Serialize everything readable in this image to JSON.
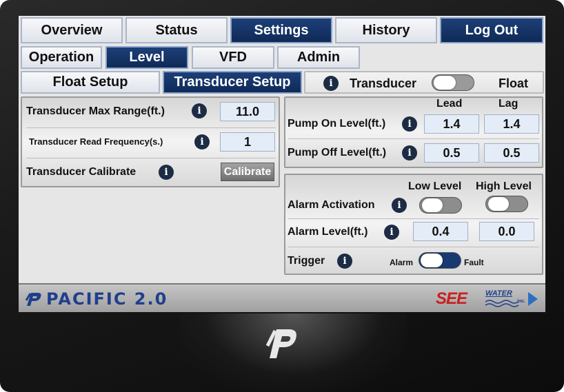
{
  "nav": {
    "tabs": [
      {
        "label": "Overview",
        "active": false
      },
      {
        "label": "Status",
        "active": false
      },
      {
        "label": "Settings",
        "active": true
      },
      {
        "label": "History",
        "active": false
      },
      {
        "label": "Log Out",
        "active": true
      }
    ]
  },
  "subnav": {
    "tabs": [
      {
        "label": "Operation",
        "active": false
      },
      {
        "label": "Level",
        "active": true
      },
      {
        "label": "VFD",
        "active": false
      },
      {
        "label": "Admin",
        "active": false
      }
    ]
  },
  "setup": {
    "float_setup": "Float Setup",
    "transducer_setup": "Transducer Setup",
    "mode_left": "Transducer",
    "mode_right": "Float"
  },
  "transducer_panel": {
    "max_range_label": "Transducer Max Range(ft.)",
    "max_range_value": "11.0",
    "read_freq_label": "Transducer Read Frequency(s.)",
    "read_freq_value": "1",
    "calibrate_label": "Transducer Calibrate",
    "calibrate_button": "Calibrate"
  },
  "pump_panel": {
    "col_lead": "Lead",
    "col_lag": "Lag",
    "on_label": "Pump On Level(ft.)",
    "on_lead": "1.4",
    "on_lag": "1.4",
    "off_label": "Pump Off Level(ft.)",
    "off_lead": "0.5",
    "off_lag": "0.5"
  },
  "alarm_panel": {
    "col_low": "Low Level",
    "col_high": "High Level",
    "activation_label": "Alarm Activation",
    "level_label": "Alarm Level(ft.)",
    "level_low": "0.4",
    "level_high": "0.0",
    "trigger_label": "Trigger",
    "trigger_left": "Alarm",
    "trigger_right": "Fault"
  },
  "footer": {
    "brand": "PACIFIC 2.0",
    "logo_see": "SEE",
    "logo_water": "WATER",
    "logo_inc": "inc."
  },
  "colors": {
    "active_tab": "#153466",
    "info_icon": "#1c2c44",
    "brand_blue": "#1f3f8c",
    "logo_red": "#c8201e"
  }
}
